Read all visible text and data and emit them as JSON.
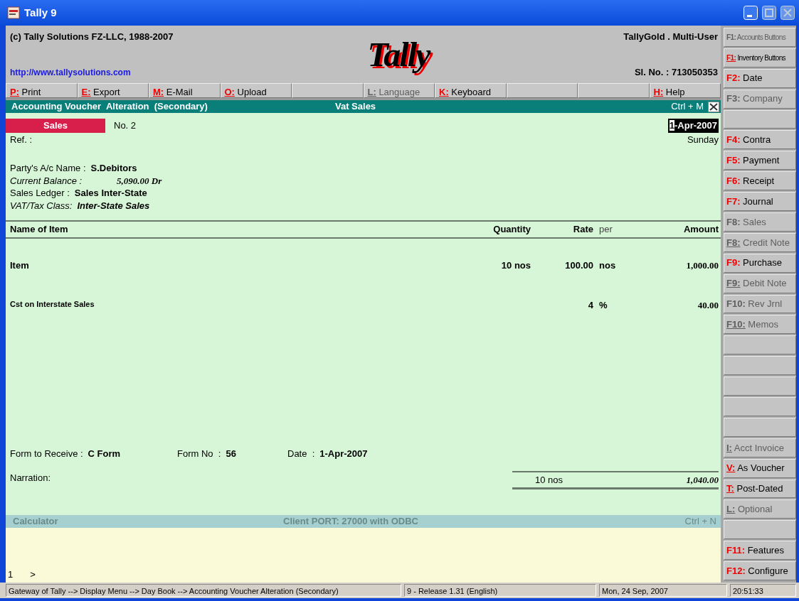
{
  "window": {
    "title": "Tally 9"
  },
  "header": {
    "copyright": "(c) Tally Solutions FZ-LLC, 1988-2007",
    "url": "http://www.tallysolutions.com",
    "logo": "Tally",
    "edition": "TallyGold . Multi-User",
    "serial": "Sl. No. : 713050353"
  },
  "toolbar": [
    {
      "kind": "key",
      "key": "P:",
      "label": "Print",
      "disabled": false
    },
    {
      "kind": "key",
      "key": "E:",
      "label": "Export",
      "disabled": false
    },
    {
      "kind": "key",
      "key": "M:",
      "label": "E-Mail",
      "disabled": false
    },
    {
      "kind": "key",
      "key": "O:",
      "label": "Upload",
      "disabled": false
    },
    {
      "kind": "blank"
    },
    {
      "kind": "key",
      "key": "L:",
      "label": "Language",
      "disabled": true
    },
    {
      "kind": "key",
      "key": "K:",
      "label": "Keyboard",
      "disabled": false
    },
    {
      "kind": "blank"
    },
    {
      "kind": "blank"
    },
    {
      "kind": "key",
      "key": "H:",
      "label": "Help",
      "disabled": false
    }
  ],
  "screen_title": {
    "left": "Accounting Voucher  Alteration  (Secondary)",
    "center": "Vat Sales",
    "shortcut": "Ctrl + M"
  },
  "voucher": {
    "type": "Sales",
    "number": "No. 2",
    "date": "1-Apr-2007",
    "day": "Sunday",
    "ref_label": "Ref. :",
    "fields": [
      {
        "label": "Party's A/c Name :",
        "value": "S.Debitors",
        "italic": false
      },
      {
        "label": "Current Balance :",
        "value": "5,090.00 Dr",
        "italic": true
      },
      {
        "label": "Sales Ledger :",
        "value": "Sales Inter-State",
        "italic": false
      },
      {
        "label": "VAT/Tax Class:",
        "value": "Inter-State Sales",
        "italic": true
      }
    ]
  },
  "table": {
    "columns": [
      "Name of Item",
      "Quantity",
      "Rate",
      "per",
      "Amount"
    ],
    "rows": [
      {
        "kind": "item",
        "name": "Item",
        "quantity": "10 nos",
        "rate": "100.00",
        "per": "nos",
        "amount": "1,000.00"
      },
      {
        "kind": "tax",
        "name": "Cst on Interstate Sales",
        "rate": "4",
        "per": "%",
        "amount": "40.00"
      }
    ],
    "total_quantity": "10 nos",
    "total_amount": "1,040.00"
  },
  "form": [
    {
      "label": "Form to Receive :",
      "value": "C Form"
    },
    {
      "label": "Form No  :",
      "value": "56"
    },
    {
      "label": "Date  :",
      "value": "1-Apr-2007"
    }
  ],
  "narration_label": "Narration:",
  "calculator": {
    "title": "Calculator",
    "center": "Client PORT: 27000 with ODBC",
    "shortcut": "Ctrl + N",
    "line": "1",
    "prompt": ">"
  },
  "side_buttons": [
    {
      "kind": "key",
      "key": "F1:",
      "label": "Accounts Buttons",
      "disabled": true,
      "underline": false
    },
    {
      "kind": "key",
      "key": "F1:",
      "label": "Inventory Buttons",
      "disabled": false,
      "underline": true
    },
    {
      "kind": "key",
      "key": "F2:",
      "label": "Date",
      "disabled": false,
      "underline": false
    },
    {
      "kind": "key",
      "key": "F3:",
      "label": "Company",
      "disabled": true,
      "underline": false
    },
    {
      "kind": "blank"
    },
    {
      "kind": "key",
      "key": "F4:",
      "label": "Contra",
      "disabled": false,
      "underline": false
    },
    {
      "kind": "key",
      "key": "F5:",
      "label": "Payment",
      "disabled": false,
      "underline": false
    },
    {
      "kind": "key",
      "key": "F6:",
      "label": "Receipt",
      "disabled": false,
      "underline": false
    },
    {
      "kind": "key",
      "key": "F7:",
      "label": "Journal",
      "disabled": false,
      "underline": false
    },
    {
      "kind": "key",
      "key": "F8:",
      "label": "Sales",
      "disabled": true,
      "underline": false
    },
    {
      "kind": "key",
      "key": "F8:",
      "label": "Credit Note",
      "disabled": true,
      "underline": true
    },
    {
      "kind": "key",
      "key": "F9:",
      "label": "Purchase",
      "disabled": false,
      "underline": false
    },
    {
      "kind": "key",
      "key": "F9:",
      "label": "Debit Note",
      "disabled": true,
      "underline": true
    },
    {
      "kind": "key",
      "key": "F10:",
      "label": "Rev Jrnl",
      "disabled": true,
      "underline": false
    },
    {
      "kind": "key",
      "key": "F10:",
      "label": "Memos",
      "disabled": true,
      "underline": true
    },
    {
      "kind": "blank"
    },
    {
      "kind": "blank"
    },
    {
      "kind": "blank"
    },
    {
      "kind": "blank"
    },
    {
      "kind": "blank"
    },
    {
      "kind": "key",
      "key": "I:",
      "label": "Acct Invoice",
      "disabled": true,
      "underline": true
    },
    {
      "kind": "key",
      "key": "V:",
      "label": "As Voucher",
      "disabled": false,
      "underline": true
    },
    {
      "kind": "key",
      "key": "T:",
      "label": "Post-Dated",
      "disabled": false,
      "underline": true
    },
    {
      "kind": "key",
      "key": "L:",
      "label": "Optional",
      "disabled": true,
      "underline": true
    },
    {
      "kind": "blank"
    },
    {
      "kind": "key",
      "key": "F11:",
      "label": "Features",
      "disabled": false,
      "underline": false
    },
    {
      "kind": "key",
      "key": "F12:",
      "label": "Configure",
      "disabled": false,
      "underline": false
    }
  ],
  "status_bar": [
    "Gateway of Tally --> Display Menu --> Day Book --> Accounting Voucher  Alteration  (Secondary)",
    "9 - Release 1.31 (English)",
    "Mon, 24 Sep, 2007",
    "20:51:33"
  ]
}
